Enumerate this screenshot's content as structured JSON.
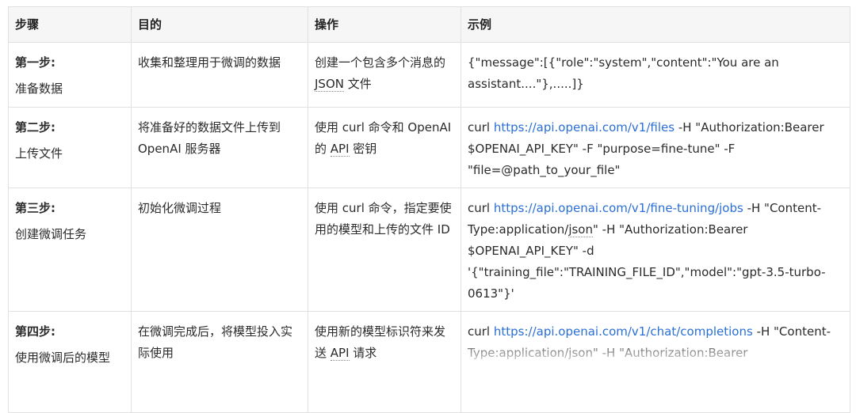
{
  "headers": [
    "步骤",
    "目的",
    "操作",
    "示例"
  ],
  "rows": [
    {
      "step_title": "第一步:",
      "step_sub": "准备数据",
      "purpose": "收集和整理用于微调的数据",
      "action_a": "创建一个包含多个消息的 ",
      "action_tech": "JSON",
      "action_b": " 文件",
      "example_a": "{\"message\":[{\"role\":\"system\",\"content\":\"You are an assistant....\"},.....]}"
    },
    {
      "step_title": "第二步:",
      "step_sub": "上传文件",
      "purpose": "将准备好的数据文件上传到 OpenAI 服务器",
      "action_a": "使用 curl 命令和 OpenAI 的 ",
      "action_tech": "API",
      "action_b": " 密钥",
      "example_a": "curl ",
      "example_link": "https://api.openai.com/v1/files",
      "example_b": " -H \"Authorization:Bearer $OPENAI_API_KEY\" -F \"purpose=fine-tune\" -F \"file=@path_to_your_file\""
    },
    {
      "step_title": "第三步:",
      "step_sub": "创建微调任务",
      "purpose": "初始化微调过程",
      "action_a": "使用 curl 命令，指定要使用的模型和上传的文件 ID",
      "example_a": "curl ",
      "example_link": "https://api.openai.com/v1/fine-tuning/jobs",
      "example_b": " -H \"Content-Type:application/",
      "example_tech": "json",
      "example_c": "\" -H \"Authorization:Bearer $OPENAI_API_KEY\"  -d '{\"training_file\":\"TRAINING_FILE_ID\",\"model\":\"gpt-3.5-turbo-0613\"}'"
    },
    {
      "step_title": "第四步:",
      "step_sub": "使用微调后的模型",
      "purpose": "在微调完成后，将模型投入实际使用",
      "action_a": "使用新的模型标识符来发送 ",
      "action_tech": "API",
      "action_b": " 请求",
      "example_a": "curl ",
      "example_link": "https://api.openai.com/v1/chat/completions",
      "example_b": " -H \"Content-Type:application/json\" -H \"Authorization:Bearer"
    }
  ]
}
